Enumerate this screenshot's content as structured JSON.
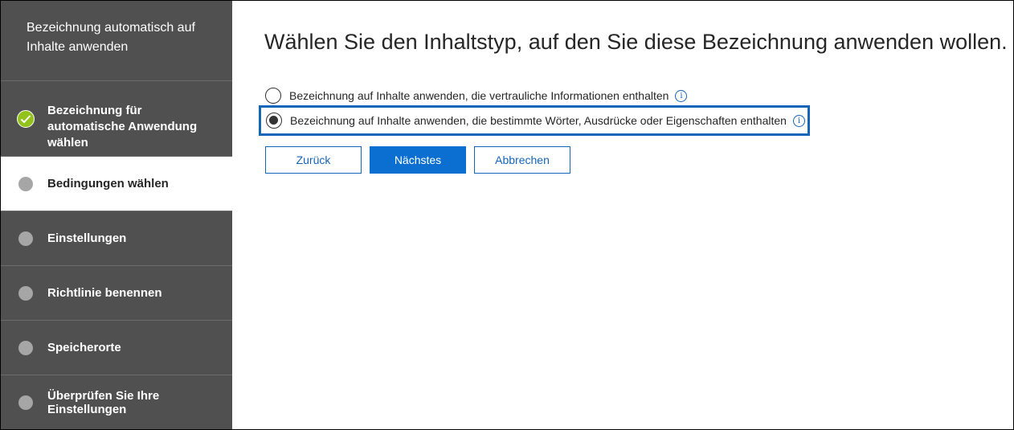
{
  "sidebar": {
    "title": "Bezeichnung automatisch auf Inhalte anwenden",
    "steps": [
      {
        "label": "Bezeichnung für automatische Anwendung wählen",
        "status": "completed"
      },
      {
        "label": "Bedingungen wählen",
        "status": "current"
      },
      {
        "label": "Einstellungen",
        "status": "pending"
      },
      {
        "label": "Richtlinie benennen",
        "status": "pending"
      },
      {
        "label": "Speicherorte",
        "status": "pending"
      },
      {
        "label": "Überprüfen Sie Ihre Einstellungen",
        "status": "pending"
      }
    ]
  },
  "main": {
    "heading": "Wählen Sie den Inhaltstyp, auf den Sie diese Bezeichnung anwenden wollen.",
    "options": [
      {
        "label": "Bezeichnung auf Inhalte anwenden, die vertrauliche Informationen enthalten",
        "selected": false,
        "icon": "info-icon"
      },
      {
        "label": "Bezeichnung auf Inhalte anwenden, die bestimmte Wörter, Ausdrücke oder Eigenschaften enthalten",
        "selected": true,
        "icon": "info-icon"
      }
    ],
    "buttons": {
      "back": "Zurück",
      "next": "Nächstes",
      "cancel": "Abbrechen"
    }
  },
  "colors": {
    "sidebar_bg": "#505050",
    "accent": "#0a6fd1",
    "highlight_border": "#1565b8",
    "check_green": "#92c21b"
  }
}
